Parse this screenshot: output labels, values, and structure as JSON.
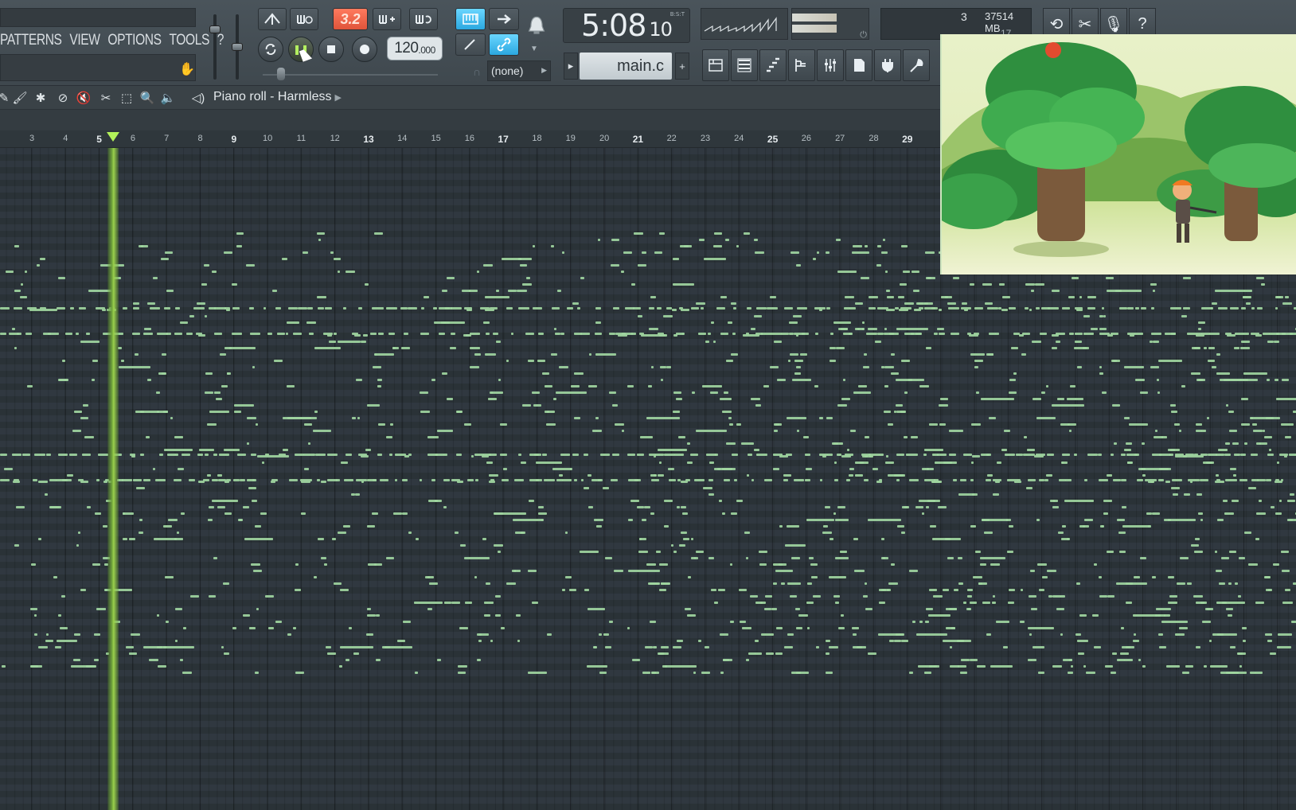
{
  "menu": {
    "items": [
      "PATTERNS",
      "VIEW",
      "OPTIONS",
      "TOOLS",
      "?"
    ]
  },
  "transport": {
    "tempo_value": "120",
    "tempo_decimal": ".000",
    "snap_label": "3.2",
    "time_main": "5:08",
    "time_sub": "10",
    "time_tag": "B:S:T"
  },
  "pattern": {
    "name": "main.c",
    "channel": "(none)"
  },
  "status": {
    "voices": "3",
    "memory": "37514 MB",
    "cpu_line": "17"
  },
  "piano_roll": {
    "title": "Piano roll - Harmless",
    "bars": [
      "3",
      "4",
      "5",
      "6",
      "7",
      "8",
      "9",
      "10",
      "11",
      "12",
      "13",
      "14",
      "15",
      "16",
      "17",
      "18",
      "19",
      "20",
      "21",
      "22",
      "23",
      "24",
      "25",
      "26",
      "27",
      "28",
      "29"
    ],
    "major_bars": [
      "5",
      "9",
      "13",
      "17",
      "21",
      "25",
      "29"
    ],
    "playhead_bar": 5.4
  },
  "icons": [
    "pitch-icon",
    "metronome-icon",
    "pattern-song-icon",
    "loop-icon",
    "pause-icon",
    "stop-icon",
    "record-icon",
    "piano-icon",
    "arrow-icon",
    "bell-icon",
    "link-icon",
    "undo-icon",
    "scissors-icon",
    "mic-icon",
    "help-icon"
  ],
  "colors": {
    "accent_red": "#e0543a",
    "accent_blue": "#2ba8e0",
    "note_green": "#9fd5a0",
    "playhead_green": "#9ad04c"
  }
}
